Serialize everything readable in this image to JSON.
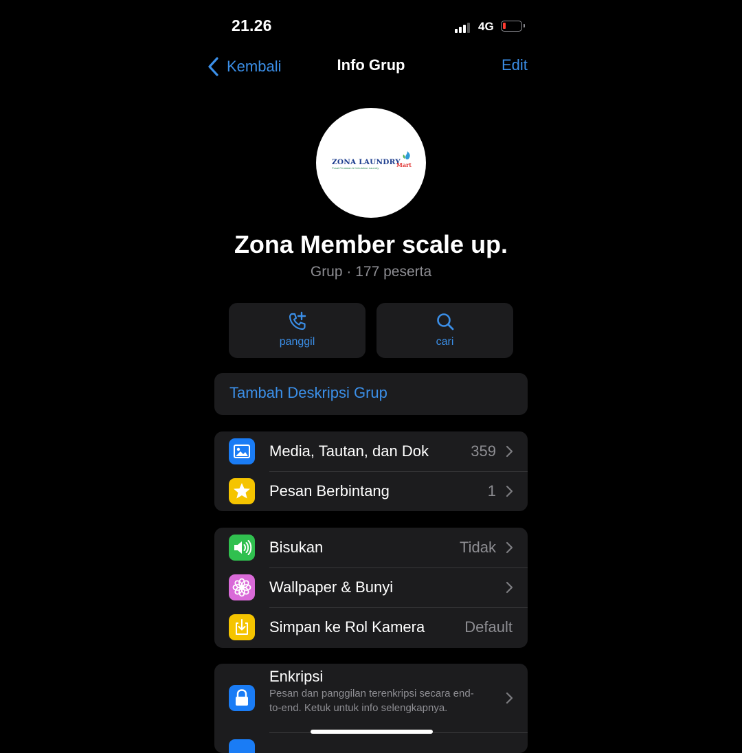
{
  "status_bar": {
    "time": "21.26",
    "network": "4G"
  },
  "nav": {
    "back_label": "Kembali",
    "title": "Info Grup",
    "edit_label": "Edit"
  },
  "group": {
    "logo_text": "ZONA LAUNDRY",
    "logo_suffix": "Mart",
    "logo_tagline": "Pusat Peralatan & Kebutuhan Laundry",
    "name": "Zona Member scale up.",
    "subtitle": "Grup · 177 peserta"
  },
  "actions": [
    {
      "label": "panggil",
      "icon": "phone-add-icon"
    },
    {
      "label": "cari",
      "icon": "search-icon"
    }
  ],
  "description_link": "Tambah Deskripsi Grup",
  "section_media": [
    {
      "label": "Media, Tautan, dan Dok",
      "value": "359",
      "icon": "photo-icon",
      "color": "#1a7cf5"
    },
    {
      "label": "Pesan Berbintang",
      "value": "1",
      "icon": "star-icon",
      "color": "#f5c400"
    }
  ],
  "section_settings": [
    {
      "label": "Bisukan",
      "value": "Tidak",
      "icon": "speaker-icon",
      "color": "#30c04f"
    },
    {
      "label": "Wallpaper & Bunyi",
      "value": "",
      "icon": "flower-icon",
      "color": "#d96ad8"
    },
    {
      "label": "Simpan ke Rol Kamera",
      "value": "Default",
      "icon": "save-download-icon",
      "color": "#f5c400"
    }
  ],
  "encryption": {
    "title": "Enkripsi",
    "description": "Pesan dan panggilan terenkripsi secara end-to-end. Ketuk untuk info selengkapnya.",
    "icon": "lock-icon",
    "color": "#1a7cf5"
  },
  "colors": {
    "accent": "#3b8fe8",
    "background": "#000000",
    "card": "#1c1c1e",
    "secondary_text": "#8e8e93",
    "battery_low": "#ff3b30"
  }
}
